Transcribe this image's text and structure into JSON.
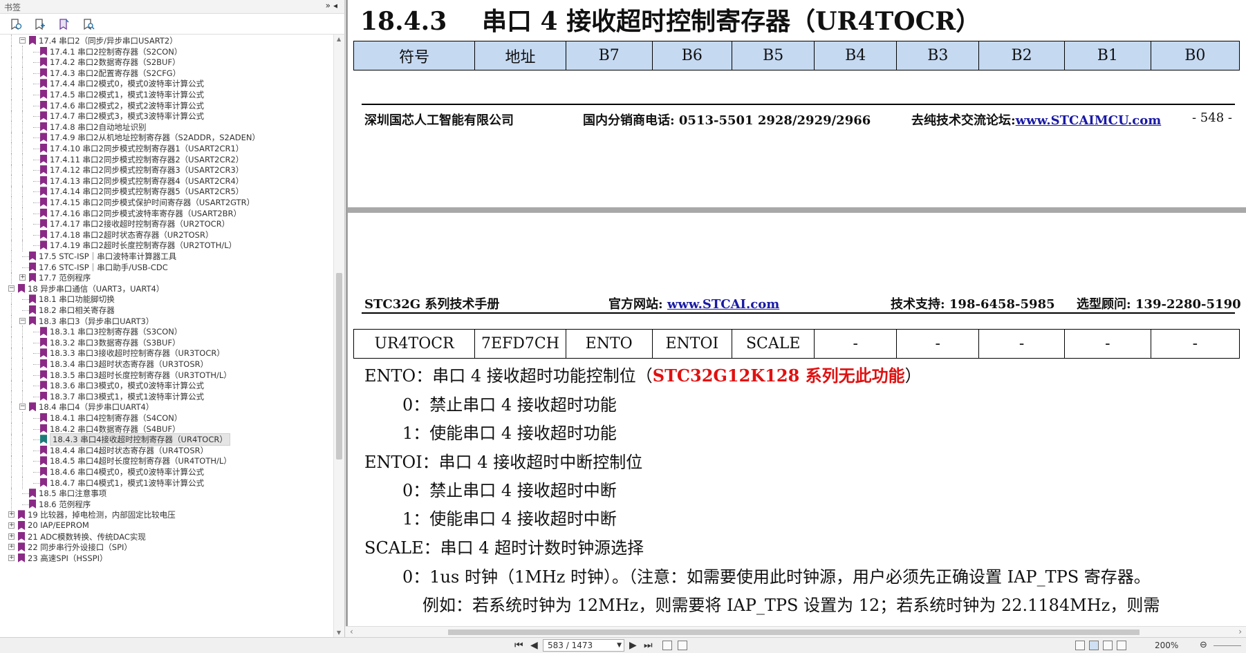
{
  "sidebar": {
    "title": "书签",
    "head_buttons": "»◂",
    "tools": [
      "bookmark-options-icon",
      "expand-bookmark-icon",
      "add-bookmark-icon",
      "find-bookmark-icon"
    ],
    "items": [
      {
        "label": "17.4  串口2（同步/异步串口USART2）",
        "level": 2,
        "exp": "−"
      },
      {
        "label": "17.4.1 串口2控制寄存器（S2CON）",
        "level": 3
      },
      {
        "label": "17.4.2 串口2数据寄存器（S2BUF）",
        "level": 3
      },
      {
        "label": "17.4.3 串口2配置寄存器（S2CFG）",
        "level": 3
      },
      {
        "label": "17.4.4 串口2模式0，模式0波特率计算公式",
        "level": 3
      },
      {
        "label": "17.4.5 串口2模式1，模式1波特率计算公式",
        "level": 3
      },
      {
        "label": "17.4.6 串口2模式2，模式2波特率计算公式",
        "level": 3
      },
      {
        "label": "17.4.7 串口2模式3，模式3波特率计算公式",
        "level": 3
      },
      {
        "label": "17.4.8 串口2自动地址识别",
        "level": 3
      },
      {
        "label": "17.4.9 串口2从机地址控制寄存器（S2ADDR，S2ADEN）",
        "level": 3
      },
      {
        "label": "17.4.10 串口2同步模式控制寄存器1（USART2CR1）",
        "level": 3
      },
      {
        "label": "17.4.11 串口2同步模式控制寄存器2（USART2CR2）",
        "level": 3
      },
      {
        "label": "17.4.12 串口2同步模式控制寄存器3（USART2CR3）",
        "level": 3
      },
      {
        "label": "17.4.13 串口2同步模式控制寄存器4（USART2CR4）",
        "level": 3
      },
      {
        "label": "17.4.14 串口2同步模式控制寄存器5（USART2CR5）",
        "level": 3
      },
      {
        "label": "17.4.15 串口2同步模式保护时间寄存器（USART2GTR）",
        "level": 3
      },
      {
        "label": "17.4.16 串口2同步模式波特率寄存器（USART2BR）",
        "level": 3
      },
      {
        "label": "17.4.17 串口2接收超时控制寄存器（UR2TOCR）",
        "level": 3
      },
      {
        "label": "17.4.18 串口2超时状态寄存器（UR2TOSR）",
        "level": 3
      },
      {
        "label": "17.4.19 串口2超时长度控制寄存器（UR2TOTH/L）",
        "level": 3
      },
      {
        "label": "17.5  STC-ISP｜串口波特率计算器工具",
        "level": 2
      },
      {
        "label": "17.6  STC-ISP｜串口助手/USB-CDC",
        "level": 2
      },
      {
        "label": "17.7  范例程序",
        "level": 2,
        "exp": "+"
      },
      {
        "label": "18  异步串口通信（UART3，UART4）",
        "level": 1,
        "exp": "−"
      },
      {
        "label": "18.1 串口功能脚切换",
        "level": 2
      },
      {
        "label": "18.2 串口相关寄存器",
        "level": 2
      },
      {
        "label": "18.3  串口3（异步串口UART3）",
        "level": 2,
        "exp": "−"
      },
      {
        "label": "18.3.1 串口3控制寄存器（S3CON）",
        "level": 3
      },
      {
        "label": "18.3.2 串口3数据寄存器（S3BUF）",
        "level": 3
      },
      {
        "label": "18.3.3 串口3接收超时控制寄存器（UR3TOCR）",
        "level": 3
      },
      {
        "label": "18.3.4 串口3超时状态寄存器（UR3TOSR）",
        "level": 3
      },
      {
        "label": "18.3.5 串口3超时长度控制寄存器（UR3TOTH/L）",
        "level": 3
      },
      {
        "label": "18.3.6 串口3模式0，模式0波特率计算公式",
        "level": 3
      },
      {
        "label": "18.3.7 串口3模式1，模式1波特率计算公式",
        "level": 3
      },
      {
        "label": "18.4  串口4（异步串口UART4）",
        "level": 2,
        "exp": "−"
      },
      {
        "label": "18.4.1 串口4控制寄存器（S4CON）",
        "level": 3
      },
      {
        "label": "18.4.2 串口4数据寄存器（S4BUF）",
        "level": 3
      },
      {
        "label": "18.4.3 串口4接收超时控制寄存器（UR4TOCR）",
        "level": 3,
        "selected": true
      },
      {
        "label": "18.4.4 串口4超时状态寄存器（UR4TOSR）",
        "level": 3
      },
      {
        "label": "18.4.5 串口4超时长度控制寄存器（UR4TOTH/L）",
        "level": 3
      },
      {
        "label": "18.4.6 串口4模式0，模式0波特率计算公式",
        "level": 3
      },
      {
        "label": "18.4.7 串口4模式1，模式1波特率计算公式",
        "level": 3
      },
      {
        "label": "18.5 串口注意事项",
        "level": 2
      },
      {
        "label": "18.6  范例程序",
        "level": 2
      },
      {
        "label": "19  比较器，掉电检测，内部固定比较电压",
        "level": 1,
        "exp": "+"
      },
      {
        "label": "20  IAP/EEPROM",
        "level": 1,
        "exp": "+"
      },
      {
        "label": "21  ADC模数转换、传统DAC实现",
        "level": 1,
        "exp": "+"
      },
      {
        "label": "22  同步串行外设接口（SPI）",
        "level": 1,
        "exp": "+"
      },
      {
        "label": "23  高速SPI（HSSPI）",
        "level": 1,
        "exp": "+"
      }
    ]
  },
  "doc": {
    "section_num": "18.4.3",
    "section_title": "串口 4 接收超时控制寄存器（UR4TOCR）",
    "header_cells": [
      "符号",
      "地址",
      "B7",
      "B6",
      "B5",
      "B4",
      "B3",
      "B2",
      "B1",
      "B0"
    ],
    "value_cells": [
      "UR4TOCR",
      "7EFD7CH",
      "ENTO",
      "ENTOI",
      "SCALE",
      "-",
      "-",
      "-",
      "-",
      "-"
    ],
    "footer": {
      "company": "深圳国芯人工智能有限公司",
      "phone": "国内分销商电话: 0513-5501 2928/2929/2966",
      "forum_label": "去纯技术交流论坛:",
      "forum_link": "www.STCAIMCU.com",
      "page": "- 548 -"
    },
    "header2": {
      "manual": "STC32G 系列技术手册",
      "site_label": "官方网站: ",
      "site_link": "www.STCAI.com",
      "support": "技术支持: 198-6458-5985",
      "advisor": "选型顾问: 139-2280-5190"
    },
    "lines": {
      "ento": "ENTO：串口 4 接收超时功能控制位（",
      "ento_red": "STC32G12K128 系列无此功能",
      "ento_end": "）",
      "ento0": "0：禁止串口 4 接收超时功能",
      "ento1": "1：使能串口 4 接收超时功能",
      "entoi": "ENTOI：串口 4 接收超时中断控制位",
      "entoi0": "0：禁止串口 4 接收超时中断",
      "entoi1": "1：使能串口 4 接收超时中断",
      "scale": "SCALE：串口 4 超时计数时钟源选择",
      "scale0": "0：1us 时钟（1MHz 时钟）。（注意：如需要使用此时钟源，用户必须先正确设置 IAP_TPS 寄存器。",
      "scale0b": "例如：若系统时钟为 12MHz，则需要将 IAP_TPS 设置为 12；若系统时钟为 22.1184MHz，则需"
    }
  },
  "status": {
    "page_value": "583 / 1473",
    "zoom": "200%"
  }
}
